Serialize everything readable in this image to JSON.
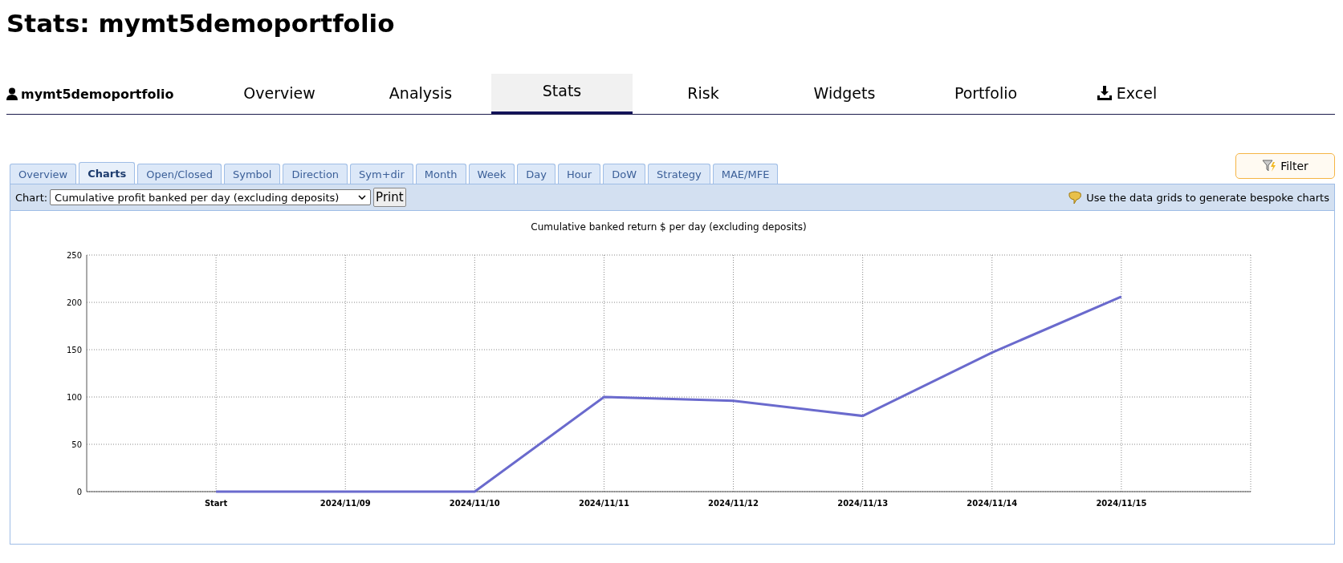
{
  "page_title": "Stats: mymt5demoportfolio",
  "nav": {
    "user": "mymt5demoportfolio",
    "items": [
      {
        "label": "Overview",
        "selected": false,
        "kind": "link"
      },
      {
        "label": "Analysis",
        "selected": false,
        "kind": "link"
      },
      {
        "label": "Stats",
        "selected": true,
        "kind": "link"
      },
      {
        "label": "Risk",
        "selected": false,
        "kind": "link"
      },
      {
        "label": "Widgets",
        "selected": false,
        "kind": "link"
      },
      {
        "label": "Portfolio",
        "selected": false,
        "kind": "link"
      },
      {
        "label": "Excel",
        "selected": false,
        "kind": "download"
      }
    ]
  },
  "filter_button": "Filter",
  "tabs": [
    {
      "label": "Overview",
      "selected": false
    },
    {
      "label": "Charts",
      "selected": true
    },
    {
      "label": "Open/Closed",
      "selected": false
    },
    {
      "label": "Symbol",
      "selected": false
    },
    {
      "label": "Direction",
      "selected": false
    },
    {
      "label": "Sym+dir",
      "selected": false
    },
    {
      "label": "Month",
      "selected": false
    },
    {
      "label": "Week",
      "selected": false
    },
    {
      "label": "Day",
      "selected": false
    },
    {
      "label": "Hour",
      "selected": false
    },
    {
      "label": "DoW",
      "selected": false
    },
    {
      "label": "Strategy",
      "selected": false
    },
    {
      "label": "MAE/MFE",
      "selected": false
    }
  ],
  "toolbar": {
    "chart_label": "Chart:",
    "chart_select": "Cumulative profit banked per day (excluding deposits)",
    "print_button": "Print",
    "hint": "Use the data grids to generate bespoke charts"
  },
  "chart_data": {
    "type": "line",
    "title": "Cumulative banked return $ per day (excluding deposits)",
    "categories": [
      "Start",
      "2024/11/09",
      "2024/11/10",
      "2024/11/11",
      "2024/11/12",
      "2024/11/13",
      "2024/11/14",
      "2024/11/15"
    ],
    "series": [
      {
        "color": "#6a6acd",
        "values": [
          0,
          0,
          0,
          100,
          96,
          80,
          147,
          206
        ]
      }
    ],
    "grid": true,
    "ylim": [
      0,
      250
    ],
    "yticks": [
      0,
      50,
      100,
      150,
      200,
      250
    ]
  }
}
